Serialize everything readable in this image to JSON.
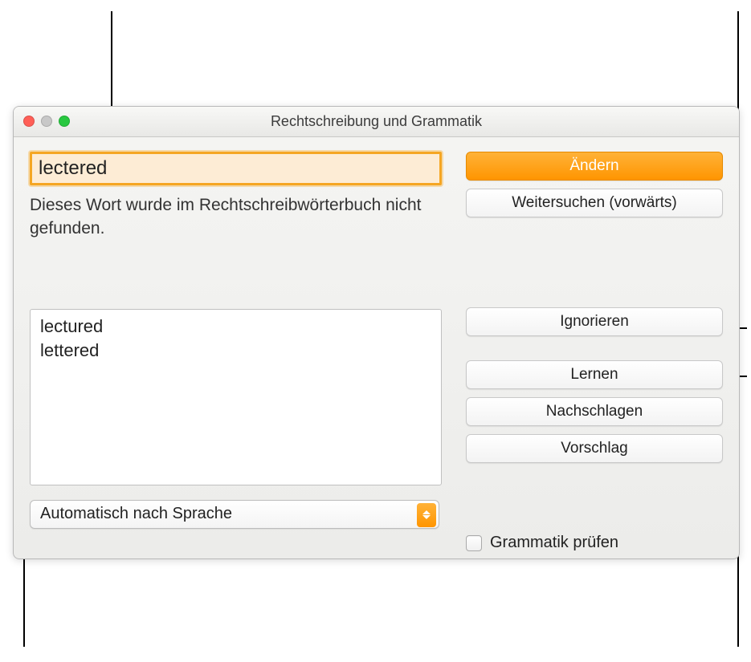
{
  "window": {
    "title": "Rechtschreibung und Grammatik"
  },
  "word_field": {
    "value": "lectered"
  },
  "status_message": "Dieses Wort wurde im Rechtschreibwörterbuch nicht gefunden.",
  "suggestions": [
    "lectured",
    "lettered"
  ],
  "language_select": {
    "selected": "Automatisch nach Sprache"
  },
  "buttons": {
    "change": "Ändern",
    "find_next": "Weitersuchen (vorwärts)",
    "ignore": "Ignorieren",
    "learn": "Lernen",
    "lookup": "Nachschlagen",
    "suggest": "Vorschlag"
  },
  "checkbox": {
    "grammar_label": "Grammatik prüfen",
    "checked": false
  },
  "colors": {
    "accent": "#ff9500",
    "highlight_border": "#f5a623",
    "highlight_bg": "#fdecd5"
  }
}
